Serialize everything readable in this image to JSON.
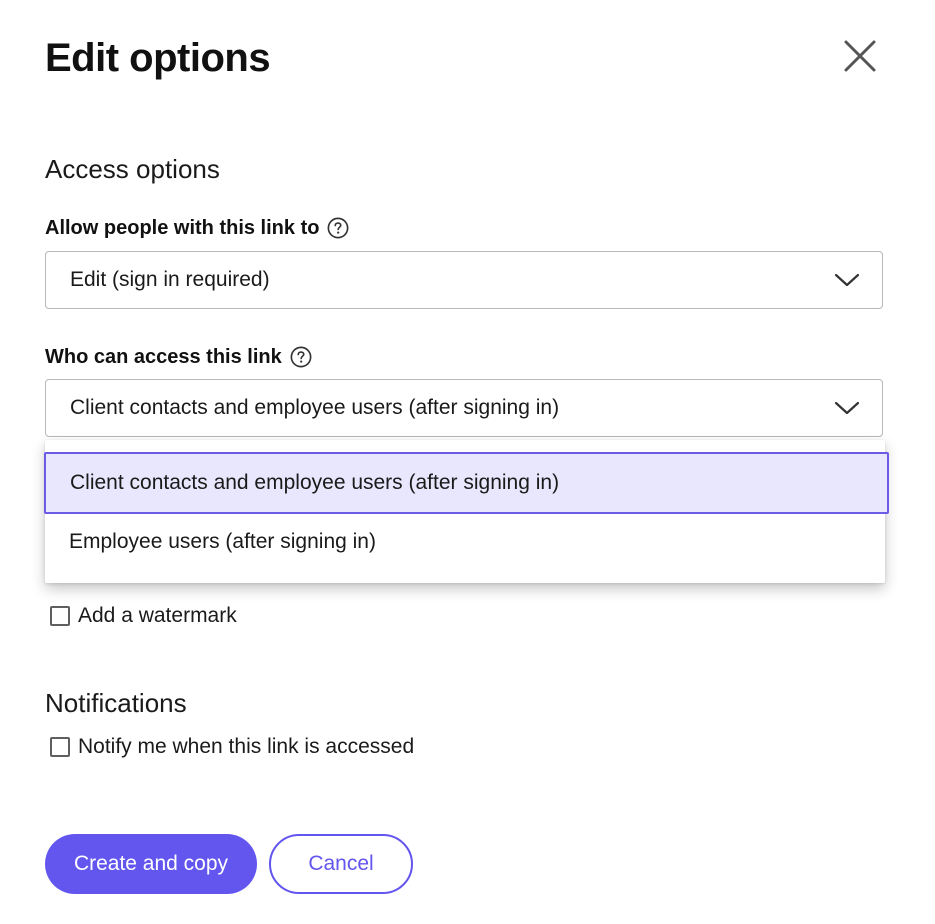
{
  "dialog": {
    "title": "Edit options",
    "close_icon": "close-icon"
  },
  "access_options": {
    "heading": "Access options",
    "permission": {
      "label": "Allow people with this link to",
      "help_icon": "question-circle-icon",
      "value": "Edit (sign in required)"
    },
    "audience": {
      "label": "Who can access this link",
      "help_icon": "question-circle-icon",
      "value": "Client contacts and employee users (after signing in)",
      "options": [
        {
          "label": "Client contacts and employee users (after signing in)",
          "selected": true
        },
        {
          "label": "Employee users (after signing in)",
          "selected": false
        }
      ]
    },
    "watermark": {
      "label": "Add a watermark",
      "checked": false
    }
  },
  "notifications": {
    "heading": "Notifications",
    "notify": {
      "label": "Notify me when this link is accessed",
      "checked": false
    }
  },
  "actions": {
    "primary_label": "Create and copy",
    "secondary_label": "Cancel"
  },
  "colors": {
    "accent": "#6356ee",
    "selected_bg": "#e9e7fd",
    "selected_border": "#6b5be6"
  }
}
